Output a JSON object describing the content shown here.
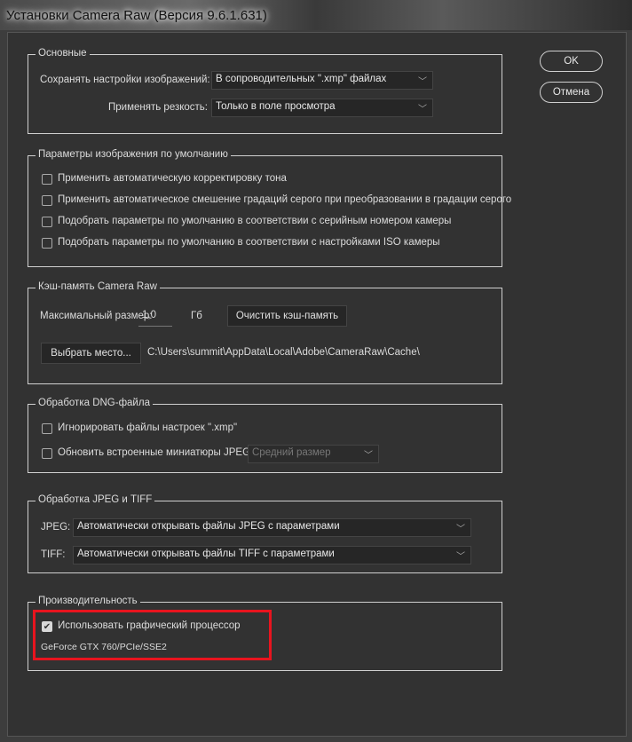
{
  "window": {
    "title": "Установки Camera Raw  (Версия 9.6.1.631)"
  },
  "buttons": {
    "ok": "OK",
    "cancel": "Отмена"
  },
  "general": {
    "legend": "Основные",
    "save_label": "Сохранять настройки изображений:",
    "save_value": "В сопроводительных \".xmp\" файлах",
    "sharpen_label": "Применять резкость:",
    "sharpen_value": "Только в поле просмотра"
  },
  "defaults": {
    "legend": "Параметры изображения по умолчанию",
    "items": [
      {
        "label": "Применить автоматическую корректировку тона",
        "checked": false
      },
      {
        "label": "Применить автоматическое смешение градаций серого при преобразовании в градации серого",
        "checked": false
      },
      {
        "label": "Подобрать параметры по умолчанию в соответствии с серийным номером камеры",
        "checked": false
      },
      {
        "label": "Подобрать параметры по умолчанию в соответствии с настройками ISO камеры",
        "checked": false
      }
    ]
  },
  "cache": {
    "legend": "Кэш-память Camera Raw",
    "max_size_label": "Максимальный размер:",
    "max_size_value": "1,0",
    "unit": "Гб",
    "purge_button": "Очистить кэш-память",
    "location_button": "Выбрать место...",
    "path": "C:\\Users\\summit\\AppData\\Local\\Adobe\\CameraRaw\\Cache\\"
  },
  "dng": {
    "legend": "Обработка DNG-файла",
    "ignore_label": "Игнорировать файлы настроек \".xmp\"",
    "ignore_checked": false,
    "update_label": "Обновить встроенные миниатюры JPEG:",
    "update_checked": false,
    "update_value": "Средний размер"
  },
  "jpegtiff": {
    "legend": "Обработка JPEG и TIFF",
    "jpeg_label": "JPEG:",
    "jpeg_value": "Автоматически открывать файлы JPEG с параметрами",
    "tiff_label": "TIFF:",
    "tiff_value": "Автоматически открывать файлы TIFF с параметрами"
  },
  "performance": {
    "legend": "Производительность",
    "gpu_label": "Использовать графический процессор",
    "gpu_checked": true,
    "gpu_name": "GeForce GTX 760/PCIe/SSE2",
    "highlight_color": "#e8141e"
  }
}
